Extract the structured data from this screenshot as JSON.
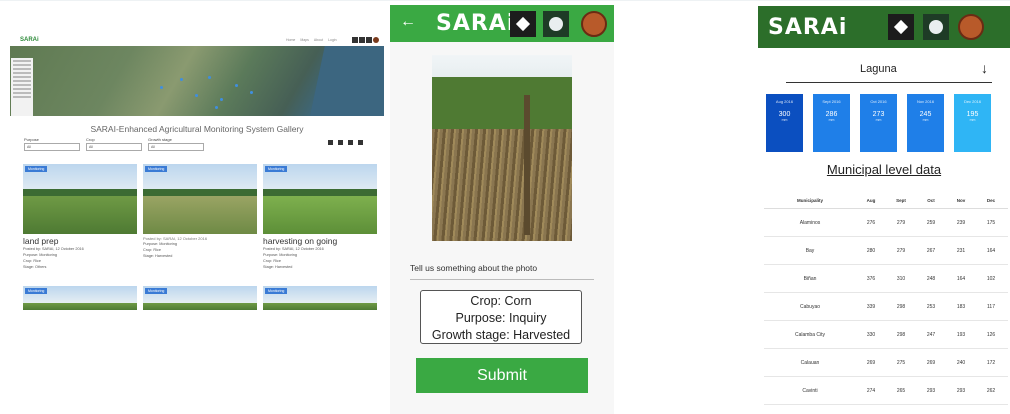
{
  "desktop": {
    "logo": "SARAi",
    "nav": [
      "Home",
      "Maps",
      "About",
      "Login"
    ],
    "title": "SARAI-Enhanced Agricultural Monitoring System Gallery",
    "filters": [
      {
        "label": "Purpose",
        "value": "All"
      },
      {
        "label": "Crop",
        "value": "All"
      },
      {
        "label": "Growth stage",
        "value": "All"
      }
    ],
    "cards": [
      {
        "tag": "Monitoring",
        "title": "land prep",
        "meta": [
          "Posted by: SARAI, 12 October 2016",
          "Purpose: Monitoring",
          "Crop: Rice",
          "Stage: Others"
        ]
      },
      {
        "tag": "Monitoring",
        "title": "Posted by: SARAI, 12 October 2016",
        "meta": [
          "Purpose: Monitoring",
          "Crop: Rice",
          "Stage: Harvested"
        ]
      },
      {
        "tag": "Monitoring",
        "title": "harvesting on going",
        "meta": [
          "Posted by: SARAI, 12 October 2016",
          "Purpose: Monitoring",
          "Crop: Rice",
          "Stage: Harvested"
        ]
      }
    ],
    "cards2": [
      {
        "tag": "Monitoring"
      },
      {
        "tag": "Monitoring"
      },
      {
        "tag": "Monitoring"
      }
    ]
  },
  "phone": {
    "back": "←",
    "logo": "SARAi",
    "question": "Tell us something about the photo",
    "details": {
      "crop": "Crop: Corn",
      "purpose": "Purpose: Inquiry",
      "stage": "Growth stage: Harvested"
    },
    "submit": "Submit"
  },
  "municipal": {
    "logo": "SARAi",
    "province": "Laguna",
    "dropdown_arrow": "↓",
    "heading": "Municipal level data",
    "months": [
      {
        "label": "Aug 2016",
        "value": "300",
        "unit": "mm"
      },
      {
        "label": "Sept 2016",
        "value": "286",
        "unit": "mm"
      },
      {
        "label": "Oct 2016",
        "value": "273",
        "unit": "mm"
      },
      {
        "label": "Nov 2016",
        "value": "245",
        "unit": "mm"
      },
      {
        "label": "Dec 2016",
        "value": "195",
        "unit": "mm"
      }
    ],
    "table": {
      "headers": [
        "Municipality",
        "Aug",
        "Sept",
        "Oct",
        "Nov",
        "Dec"
      ],
      "rows": [
        [
          "Alaminos",
          "276",
          "279",
          "259",
          "239",
          "175"
        ],
        [
          "Bay",
          "280",
          "279",
          "267",
          "231",
          "164"
        ],
        [
          "Biñan",
          "376",
          "310",
          "248",
          "164",
          "102"
        ],
        [
          "Cabuyao",
          "339",
          "298",
          "253",
          "183",
          "117"
        ],
        [
          "Calamba City",
          "330",
          "298",
          "247",
          "193",
          "126"
        ],
        [
          "Calauan",
          "269",
          "275",
          "269",
          "240",
          "172"
        ],
        [
          "Cavinti",
          "274",
          "265",
          "293",
          "293",
          "262"
        ]
      ]
    }
  }
}
